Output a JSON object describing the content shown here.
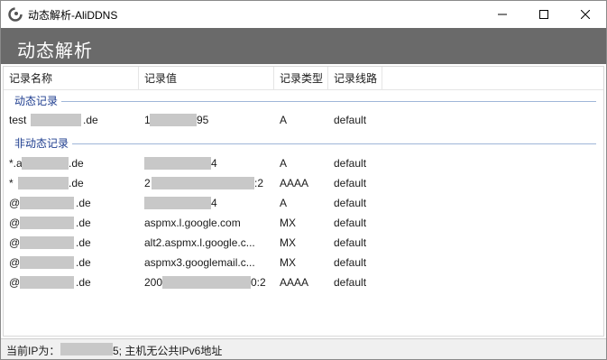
{
  "window": {
    "title": "动态解析-AliDDNS",
    "app_icon": "aliddns-logo-icon",
    "controls": {
      "minimize": "minimize-icon",
      "maximize": "maximize-icon",
      "close": "close-icon"
    }
  },
  "banner": {
    "title": "动态解析"
  },
  "list": {
    "columns": [
      "记录名称",
      "记录值",
      "记录类型",
      "记录线路"
    ],
    "groups": [
      {
        "label": "动态记录",
        "rows": [
          {
            "name_pre": "test",
            "name_post": ".de",
            "value_pre": "1",
            "value_post": "95",
            "type": "A",
            "line": "default"
          }
        ]
      },
      {
        "label": "非动态记录",
        "rows": [
          {
            "name_pre": "*.a",
            "name_post": ".de",
            "value_pre": "",
            "value_post": "4",
            "type": "A",
            "line": "default"
          },
          {
            "name_pre": "*",
            "name_post": ".de",
            "value_pre": "2",
            "value_post": ":2",
            "type": "AAAA",
            "line": "default"
          },
          {
            "name_pre": "@",
            "name_post": ".de",
            "value_pre": "",
            "value_post": "4",
            "type": "A",
            "line": "default"
          },
          {
            "name_pre": "@",
            "name_post": ".de",
            "value_pre": "aspmx.l.google.com",
            "value_post": "",
            "type": "MX",
            "line": "default"
          },
          {
            "name_pre": "@",
            "name_post": ".de",
            "value_pre": "alt2.aspmx.l.google.c...",
            "value_post": "",
            "type": "MX",
            "line": "default"
          },
          {
            "name_pre": "@",
            "name_post": ".de",
            "value_pre": "aspmx3.googlemail.c...",
            "value_post": "",
            "type": "MX",
            "line": "default"
          },
          {
            "name_pre": "@",
            "name_post": ".de",
            "value_pre": "200",
            "value_post": "0:2",
            "type": "AAAA",
            "line": "default"
          }
        ]
      }
    ]
  },
  "status": {
    "prefix": "当前IP为：",
    "suffix": "5; 主机无公共IPv6地址"
  },
  "colors": {
    "banner": "#6a6a6a",
    "group_label": "#1e3d8f",
    "group_line": "#9fb6d8",
    "redaction": "#c8c8c8"
  }
}
